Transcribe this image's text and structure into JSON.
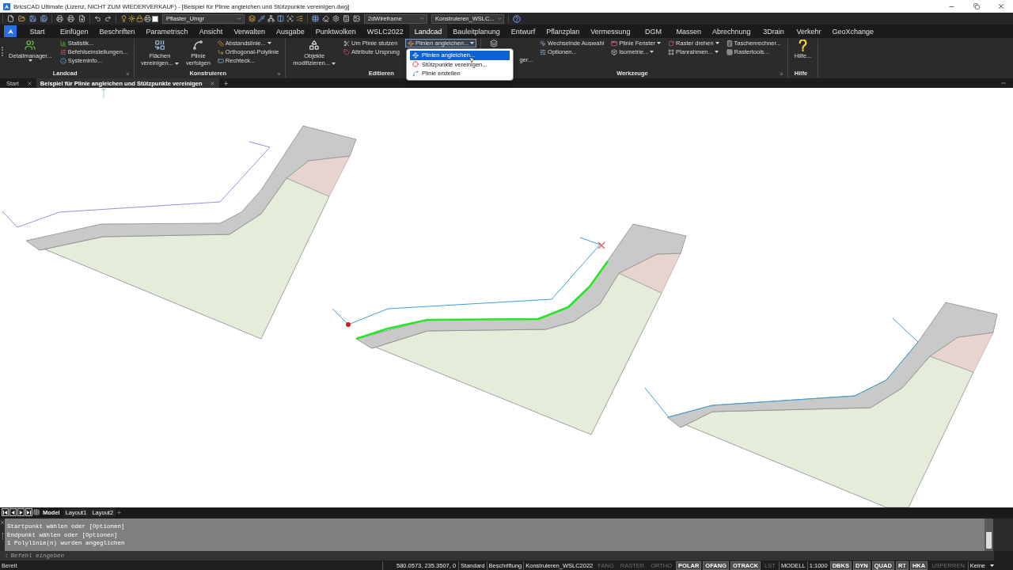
{
  "window": {
    "title": "BricsCAD Ultimate (Lizenz, NICHT ZUM WIEDERVERKAUF) - [Beispiel für Plinie angleichen und Stützpunkte vereinigen.dwg]"
  },
  "quick_access": {
    "layer": "Pflaster_Umgr",
    "visual_style": "2dWireframe",
    "workspace": "Konstruieren_WSLC..."
  },
  "ribbon_tabs": [
    {
      "label": "Start",
      "selected": false
    },
    {
      "label": "Einfügen",
      "selected": false
    },
    {
      "label": "Beschriften",
      "selected": false
    },
    {
      "label": "Parametrisch",
      "selected": false
    },
    {
      "label": "Ansicht",
      "selected": false
    },
    {
      "label": "Verwalten",
      "selected": false
    },
    {
      "label": "Ausgabe",
      "selected": false
    },
    {
      "label": "Punktwolken",
      "selected": false
    },
    {
      "label": "WSLC2022",
      "selected": false
    },
    {
      "label": "Landcad",
      "selected": true
    },
    {
      "label": "Bauleitplanung",
      "selected": false
    },
    {
      "label": "Entwurf",
      "selected": false
    },
    {
      "label": "Pflanzplan",
      "selected": false
    },
    {
      "label": "Vermessung",
      "selected": false
    },
    {
      "label": "DGM",
      "selected": false
    },
    {
      "label": "Massen",
      "selected": false
    },
    {
      "label": "Abrechnung",
      "selected": false
    },
    {
      "label": "3Drain",
      "selected": false
    },
    {
      "label": "Verkehr",
      "selected": false
    },
    {
      "label": "GeoXchange",
      "selected": false
    }
  ],
  "ribbon_panels": [
    {
      "title": "Landcad",
      "launcher": true,
      "groups": [
        {
          "kind": "large",
          "lines": [
            "Detailmanager..."
          ],
          "dropdown": true,
          "expanded": false
        },
        {
          "kind": "stack",
          "items": [
            {
              "label": "Statistik...",
              "dropdown": false,
              "expanded": false
            },
            {
              "label": "Befehlseinstellungen...",
              "dropdown": false,
              "expanded": false
            },
            {
              "label": "Systeminfo...",
              "dropdown": false,
              "expanded": false
            }
          ]
        }
      ]
    },
    {
      "title": "Konstruieren",
      "launcher": true,
      "groups": [
        {
          "kind": "large",
          "lines": [
            "Flächen",
            "vereinigen..."
          ],
          "dropdown": true,
          "expanded": false
        },
        {
          "kind": "large",
          "lines": [
            "Plinie",
            "verfolgen"
          ],
          "dropdown": false,
          "expanded": false
        },
        {
          "kind": "stack",
          "items": [
            {
              "label": "Abstandslinie...",
              "dropdown": true,
              "expanded": false
            },
            {
              "label": "Orthogonal-Polylinie",
              "dropdown": false,
              "expanded": false
            },
            {
              "label": "Rechteck...",
              "dropdown": false,
              "expanded": false
            }
          ]
        }
      ]
    },
    {
      "title": "Editieren",
      "launcher": false,
      "groups": [
        {
          "kind": "large",
          "lines": [
            "Objekte",
            "modifizieren..."
          ],
          "dropdown": true,
          "expanded": false
        },
        {
          "kind": "stack",
          "items": [
            {
              "label": "Um Plinie stutzen",
              "dropdown": false,
              "expanded": false
            },
            {
              "label": "Attribute Ursprung",
              "dropdown": false,
              "expanded": false
            }
          ]
        },
        {
          "kind": "stack",
          "items": [
            {
              "label": "Plinien angleichen...",
              "dropdown": true,
              "expanded": true
            }
          ]
        }
      ]
    },
    {
      "title": "Werkzeuge",
      "launcher": true,
      "groups": [
        {
          "kind": "large",
          "lines": [
            "ger..."
          ],
          "dropdown": false,
          "expanded": false
        },
        {
          "kind": "stack",
          "items": [
            {
              "label": "Wechselnde Auswahl",
              "dropdown": false,
              "expanded": false
            },
            {
              "label": "Optionen...",
              "dropdown": false,
              "expanded": false
            }
          ]
        },
        {
          "kind": "stack",
          "items": [
            {
              "label": "Plinie Fenster",
              "dropdown": true,
              "expanded": false
            },
            {
              "label": "Isometrie...",
              "dropdown": true,
              "expanded": false
            }
          ]
        },
        {
          "kind": "stack",
          "items": [
            {
              "label": "Raster drehen",
              "dropdown": true,
              "expanded": false
            },
            {
              "label": "Planrahmen...",
              "dropdown": true,
              "expanded": false
            }
          ]
        },
        {
          "kind": "stack",
          "items": [
            {
              "label": "Taschenrechner...",
              "dropdown": false,
              "expanded": false
            },
            {
              "label": "Rastertools...",
              "dropdown": false,
              "expanded": false
            }
          ]
        }
      ]
    },
    {
      "title": "Hilfe",
      "launcher": false,
      "groups": [
        {
          "kind": "large",
          "lines": [
            "Hilfe..."
          ],
          "dropdown": false,
          "expanded": false
        }
      ]
    }
  ],
  "open_menu": {
    "items": [
      {
        "label": "Plinien angleichen...",
        "selected": true
      },
      {
        "label": "Stützpunkte vereinigen...",
        "selected": false
      },
      {
        "label": "Plinie erstellen",
        "selected": false
      }
    ]
  },
  "document_tabs": [
    {
      "label": "Start",
      "selected": false
    },
    {
      "label": "Beispiel für Plinie angleichen und Stützpunkte vereinigen",
      "selected": true
    }
  ],
  "layout_tabs": [
    {
      "label": "Model",
      "selected": true
    },
    {
      "label": "Layout1",
      "selected": false
    },
    {
      "label": "Layout2",
      "selected": false
    }
  ],
  "command_history": [
    "Startpunkt wählen oder [Optionen]",
    "Endpunkt wählen oder [Optionen]",
    "1 Polylinie(n) wurden angeglichen"
  ],
  "command_line": {
    "prompt": ":",
    "placeholder": "Befehl eingeben"
  },
  "status_bar": {
    "message": "Bereit",
    "items": [
      {
        "kind": "coordinates",
        "label": "580.0573, 235.3507, 0"
      },
      {
        "kind": "text",
        "label": "Standard"
      },
      {
        "kind": "text",
        "label": "Beschriftung"
      },
      {
        "kind": "text",
        "label": "Konstruieren_WSLC2022"
      },
      {
        "kind": "toggle",
        "label": "FANG",
        "on": false
      },
      {
        "kind": "toggle",
        "label": "RASTER",
        "on": false
      },
      {
        "kind": "toggle",
        "label": "ORTHO",
        "on": false
      },
      {
        "kind": "toggle",
        "label": "POLAR",
        "on": true
      },
      {
        "kind": "toggle",
        "label": "OFANG",
        "on": true
      },
      {
        "kind": "toggle",
        "label": "OTRACK",
        "on": true
      },
      {
        "kind": "toggle",
        "label": "LST",
        "on": false
      },
      {
        "kind": "text",
        "label": "MODELL"
      },
      {
        "kind": "text",
        "label": "1:1000"
      },
      {
        "kind": "toggle",
        "label": "DBKS",
        "on": true
      },
      {
        "kind": "toggle",
        "label": "DYN",
        "on": true
      },
      {
        "kind": "toggle",
        "label": "QUAD",
        "on": true
      },
      {
        "kind": "toggle",
        "label": "RT",
        "on": true
      },
      {
        "kind": "toggle",
        "label": "HKA",
        "on": true
      },
      {
        "kind": "toggle",
        "label": "USPERREN",
        "on": false
      },
      {
        "kind": "text",
        "label": "Keine"
      }
    ]
  }
}
